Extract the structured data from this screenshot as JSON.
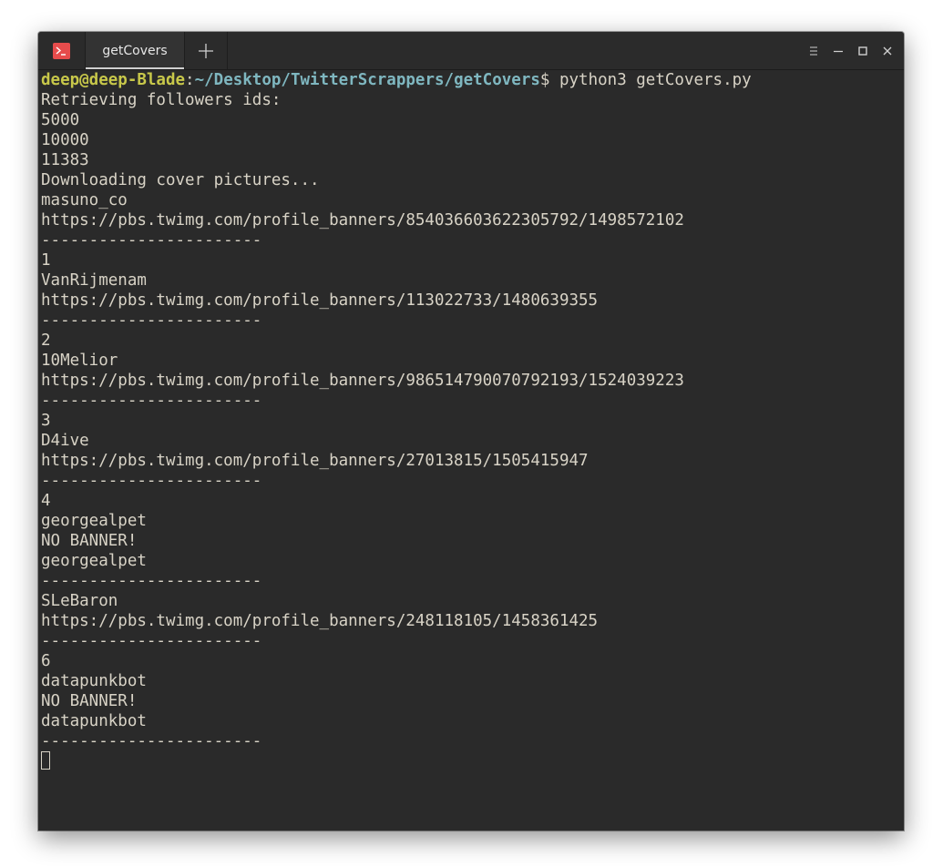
{
  "titlebar": {
    "tab_title": "getCovers"
  },
  "icons": {
    "app": "terminal-icon",
    "new_tab": "plus-icon",
    "menu": "hamburger-menu-icon",
    "minimize": "minimize-icon",
    "maximize": "maximize-icon",
    "close": "close-icon"
  },
  "colors": {
    "background": "#2a2a2a",
    "text": "#d8d3c6",
    "prompt_user": "#c8c84a",
    "prompt_path": "#7fb7c0",
    "app_icon": "#e74c4c"
  },
  "prompt": {
    "user_host": "deep@deep-Blade",
    "colon": ":",
    "path": "~/Desktop/TwitterScrappers/getCovers",
    "dollar": "$",
    "command": " python3 getCovers.py"
  },
  "output": [
    "Retrieving followers ids:",
    "5000",
    "10000",
    "11383",
    "Downloading cover pictures...",
    "masuno_co",
    "https://pbs.twimg.com/profile_banners/854036603622305792/1498572102",
    "-----------------------",
    "1",
    "VanRijmenam",
    "https://pbs.twimg.com/profile_banners/113022733/1480639355",
    "-----------------------",
    "2",
    "10Melior",
    "https://pbs.twimg.com/profile_banners/986514790070792193/1524039223",
    "-----------------------",
    "3",
    "D4ive",
    "https://pbs.twimg.com/profile_banners/27013815/1505415947",
    "-----------------------",
    "4",
    "georgealpet",
    "NO BANNER!",
    "georgealpet",
    "-----------------------",
    "SLeBaron",
    "https://pbs.twimg.com/profile_banners/248118105/1458361425",
    "-----------------------",
    "6",
    "datapunkbot",
    "NO BANNER!",
    "datapunkbot",
    "-----------------------"
  ]
}
